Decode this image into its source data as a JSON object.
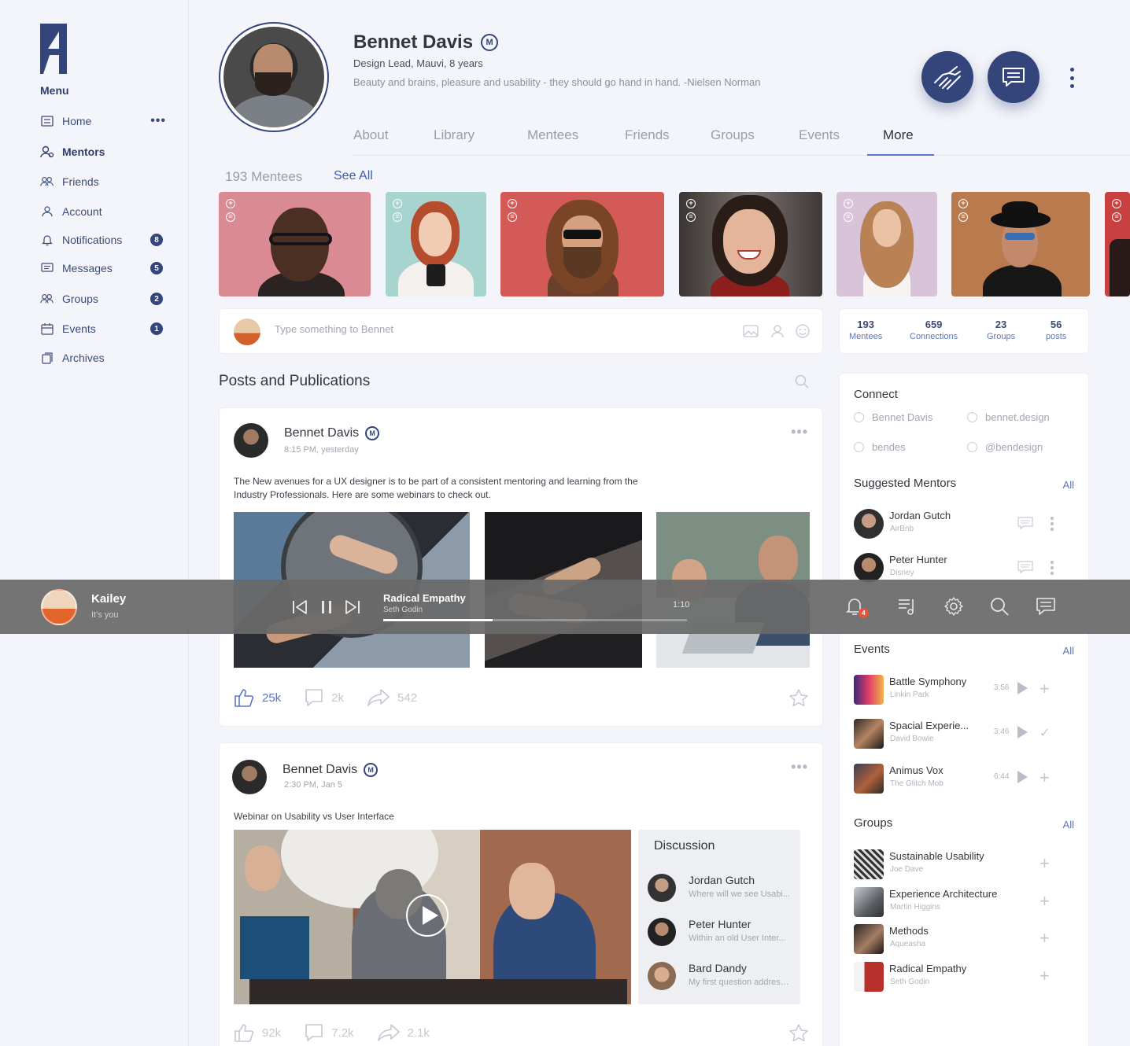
{
  "sidebar": {
    "menu_title": "Menu",
    "items": [
      {
        "label": "Home",
        "badge": "",
        "icon": "home-icon"
      },
      {
        "label": "Mentors",
        "badge": "",
        "icon": "mentors-icon"
      },
      {
        "label": "Friends",
        "badge": "",
        "icon": "friends-icon"
      },
      {
        "label": "Account",
        "badge": "",
        "icon": "account-icon"
      },
      {
        "label": "Notifications",
        "badge": "8",
        "icon": "bell-icon"
      },
      {
        "label": "Messages",
        "badge": "5",
        "icon": "message-icon"
      },
      {
        "label": "Groups",
        "badge": "2",
        "icon": "groups-icon"
      },
      {
        "label": "Events",
        "badge": "1",
        "icon": "calendar-icon"
      },
      {
        "label": "Archives",
        "badge": "",
        "icon": "archive-icon"
      }
    ],
    "home_more": "•••",
    "active": "Mentors"
  },
  "profile": {
    "name": "Bennet Davis",
    "badge": "M",
    "subtitle": "Design Lead, Mauvi, 8 years",
    "quote": "Beauty and brains, pleasure and usability - they should go hand in hand. -Nielsen Norman"
  },
  "tabs": [
    "About",
    "Library",
    "Mentees",
    "Friends",
    "Groups",
    "Events",
    "More"
  ],
  "active_tab": "More",
  "mentees": {
    "count_label": "193 Mentees",
    "see_all": "See All"
  },
  "composer": {
    "placeholder": "Type something to Bennet"
  },
  "stats": [
    {
      "value": "193",
      "label": "Mentees"
    },
    {
      "value": "659",
      "label": "Connections"
    },
    {
      "value": "23",
      "label": "Groups"
    },
    {
      "value": "56",
      "label": "posts"
    }
  ],
  "posts_section": {
    "title": "Posts and Publications"
  },
  "posts": [
    {
      "author": "Bennet Davis",
      "badge": "M",
      "time": "8:15 PM, yesterday",
      "text": "The New avenues for a UX designer is to be part of a consistent mentoring and learning from the Industry Professionals. Here are some webinars to check out.",
      "likes": "25k",
      "comments": "2k",
      "shares": "542",
      "more": "•••"
    },
    {
      "author": "Bennet Davis",
      "badge": "M",
      "time": "2:30 PM, Jan 5",
      "text": "Webinar on Usability vs User Interface",
      "likes": "92k",
      "comments": "7.2k",
      "shares": "2.1k",
      "more": "•••",
      "discussion": {
        "title": "Discussion",
        "items": [
          {
            "name": "Jordan Gutch",
            "text": "Where will we see Usabi..."
          },
          {
            "name": "Peter Hunter",
            "text": "Within an old User Inter..."
          },
          {
            "name": "Bard Dandy",
            "text": "My first question address..."
          }
        ]
      }
    }
  ],
  "connect": {
    "title": "Connect",
    "links": [
      "Bennet Davis",
      "bennet.design",
      "bendes",
      "@bendesign"
    ]
  },
  "suggested_mentors": {
    "title": "Suggested Mentors",
    "all": "All",
    "items": [
      {
        "name": "Jordan Gutch",
        "company": "AirBnb"
      },
      {
        "name": "Peter Hunter",
        "company": "Disney"
      }
    ]
  },
  "events": {
    "title": "Events",
    "all": "All",
    "items": [
      {
        "name": "Battle Symphony",
        "artist": "Linkin Park",
        "duration": "3:56",
        "state": "add"
      },
      {
        "name": "Spacial Experie...",
        "artist": "David Bowie",
        "duration": "3:46",
        "state": "added"
      },
      {
        "name": "Animus Vox",
        "artist": "The Glitch Mob",
        "duration": "6:44",
        "state": "add"
      }
    ]
  },
  "groups": {
    "title": "Groups",
    "all": "All",
    "items": [
      {
        "name": "Sustainable Usability",
        "owner": "Joe Dave"
      },
      {
        "name": "Experience Architecture",
        "owner": "Martin Higgins"
      },
      {
        "name": "Methods",
        "owner": "Aqueasha"
      },
      {
        "name": "Radical Empathy",
        "owner": "Seth Godin"
      }
    ]
  },
  "player": {
    "user_name": "Kailey",
    "user_sub": "It's you",
    "track_title": "Radical Empathy",
    "track_artist": "Seth Godin",
    "duration": "1:10",
    "progress": 0.36,
    "notification_count": "4"
  },
  "colors": {
    "brand": "#34457c",
    "accent": "#5a75c9",
    "link": "#3e5bb0",
    "badge_alert": "#e5553b"
  }
}
